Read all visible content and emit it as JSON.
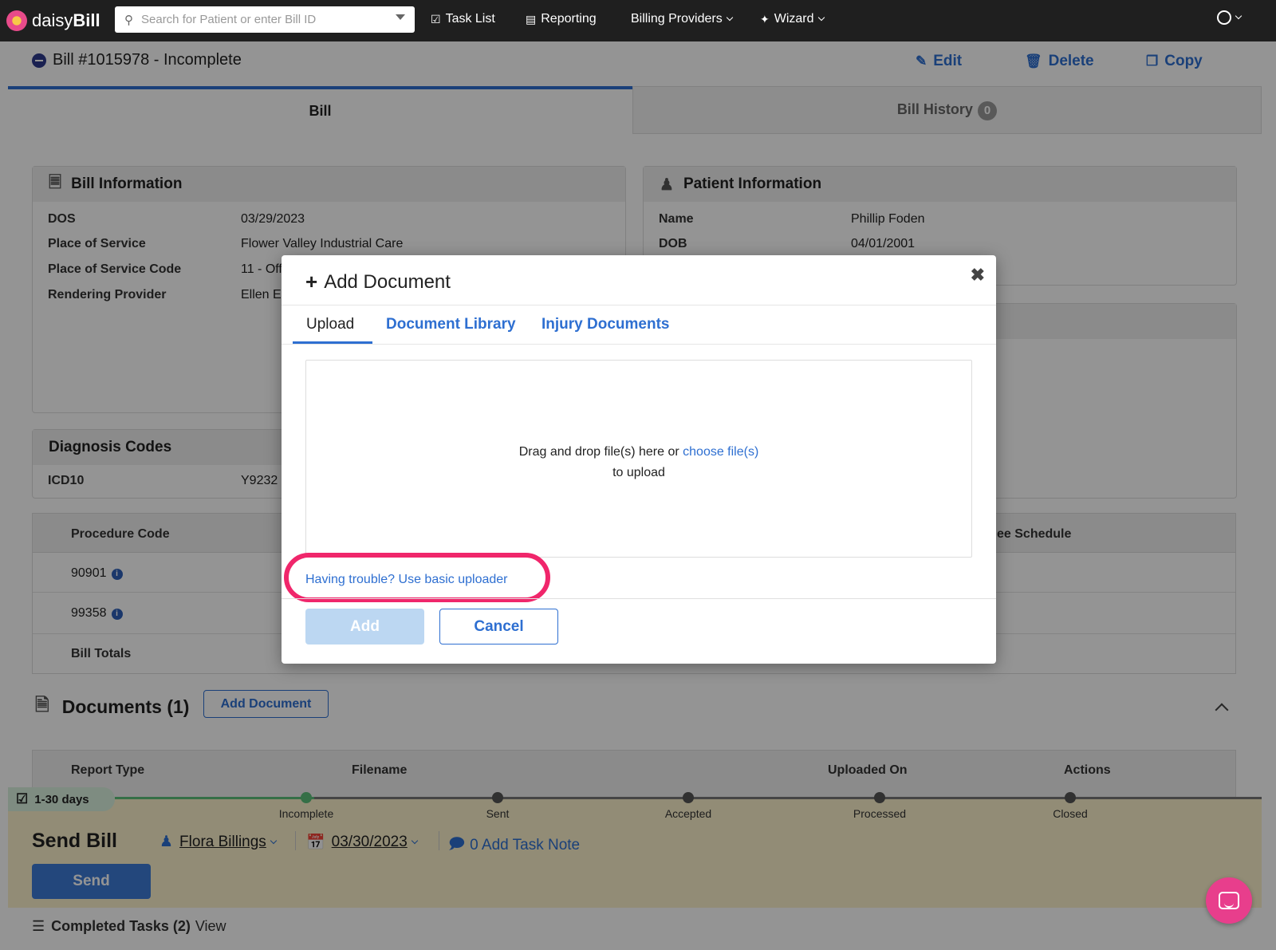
{
  "nav": {
    "brand_a": "daisy",
    "brand_b": "Bill",
    "search_placeholder": "Search for Patient or enter Bill ID",
    "task_list": "Task List",
    "reporting": "Reporting",
    "billing_providers": "Billing Providers",
    "wizard": "Wizard"
  },
  "bill": {
    "title": "Bill #1015978 - Incomplete",
    "edit": "Edit",
    "delete": "Delete",
    "copy": "Copy",
    "tab_bill": "Bill",
    "tab_history": "Bill History",
    "history_count": "0"
  },
  "bill_info": {
    "header": "Bill Information",
    "rows": [
      {
        "label": "DOS",
        "value": "03/29/2023"
      },
      {
        "label": "Place of Service",
        "value": "Flower Valley Industrial Care"
      },
      {
        "label": "Place of Service Code",
        "value": "11 - Off"
      },
      {
        "label": "Rendering Provider",
        "value": "Ellen E"
      }
    ]
  },
  "patient_info": {
    "header": "Patient Information",
    "rows": [
      {
        "label": "Name",
        "value": "Phillip Foden"
      },
      {
        "label": "DOB",
        "value": "04/01/2001"
      }
    ]
  },
  "diagnosis": {
    "header": "Diagnosis Codes",
    "label": "ICD10",
    "value": "Y9232"
  },
  "procedures": {
    "col_code": "Procedure Code",
    "col_fee": "ee Schedule",
    "rows": [
      {
        "code": "90901"
      },
      {
        "code": "99358"
      }
    ],
    "totals": "Bill Totals"
  },
  "documents": {
    "title": "Documents (1)",
    "add_button": "Add Document",
    "cols": [
      "Report Type",
      "Filename",
      "Uploaded On",
      "Actions"
    ]
  },
  "workflow": {
    "pill": "1-30 days",
    "steps": [
      "Incomplete",
      "Sent",
      "Accepted",
      "Processed",
      "Closed"
    ],
    "title": "Send Bill",
    "assignee": "Flora Billings",
    "date": "03/30/2023",
    "note": "0 Add Task Note",
    "send": "Send",
    "completed_label": "Completed Tasks (2)",
    "completed_view": "View"
  },
  "modal": {
    "title": "Add Document",
    "tabs": [
      "Upload",
      "Document Library",
      "Injury Documents"
    ],
    "drop_text": "Drag and drop file(s) here or",
    "drop_link": "choose file(s)",
    "drop_text2": "to upload",
    "basic_link": "Having trouble? Use basic uploader",
    "add": "Add",
    "cancel": "Cancel"
  },
  "colors": {
    "accent": "#2e6fd1",
    "highlight": "#f0266b",
    "workflow_bg": "#fbf2cc"
  }
}
